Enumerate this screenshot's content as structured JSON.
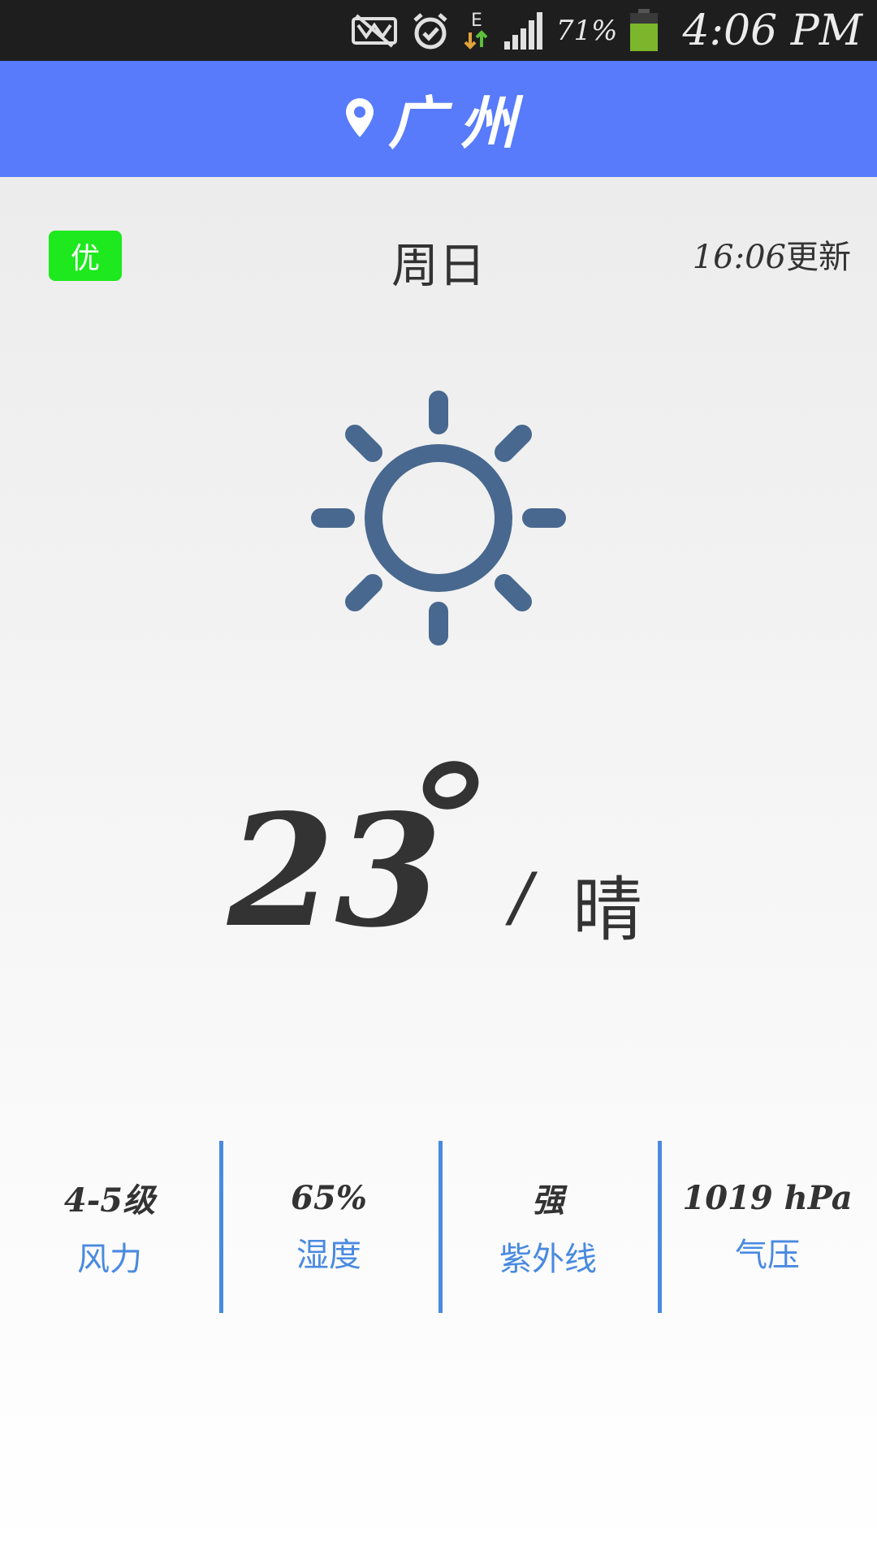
{
  "status_bar": {
    "battery_percent": "71%",
    "clock": "4:06 PM",
    "network_type": "E",
    "icons": [
      "no-sim-icon",
      "alarm-icon",
      "data-arrows-icon",
      "signal-icon",
      "battery-icon"
    ],
    "battery_color": "#7cb62c"
  },
  "header": {
    "city": "广州",
    "icon": "location-pin-icon",
    "bg_color": "#577bfa"
  },
  "main": {
    "aqi_badge": "优",
    "aqi_color": "#1ee81e",
    "weekday": "周日",
    "updated_time": "16:06",
    "updated_suffix": "更新",
    "weather_icon": "sun-icon",
    "icon_color": "#48688f",
    "temperature": "23",
    "slash": "/",
    "condition": "晴"
  },
  "stats": [
    {
      "value": "4-5级",
      "label": "风力"
    },
    {
      "value": "65%",
      "label": "湿度"
    },
    {
      "value": "强",
      "label": "紫外线"
    },
    {
      "value": "1019 hPa",
      "label": "气压"
    }
  ],
  "accent_color": "#4a8ae0"
}
